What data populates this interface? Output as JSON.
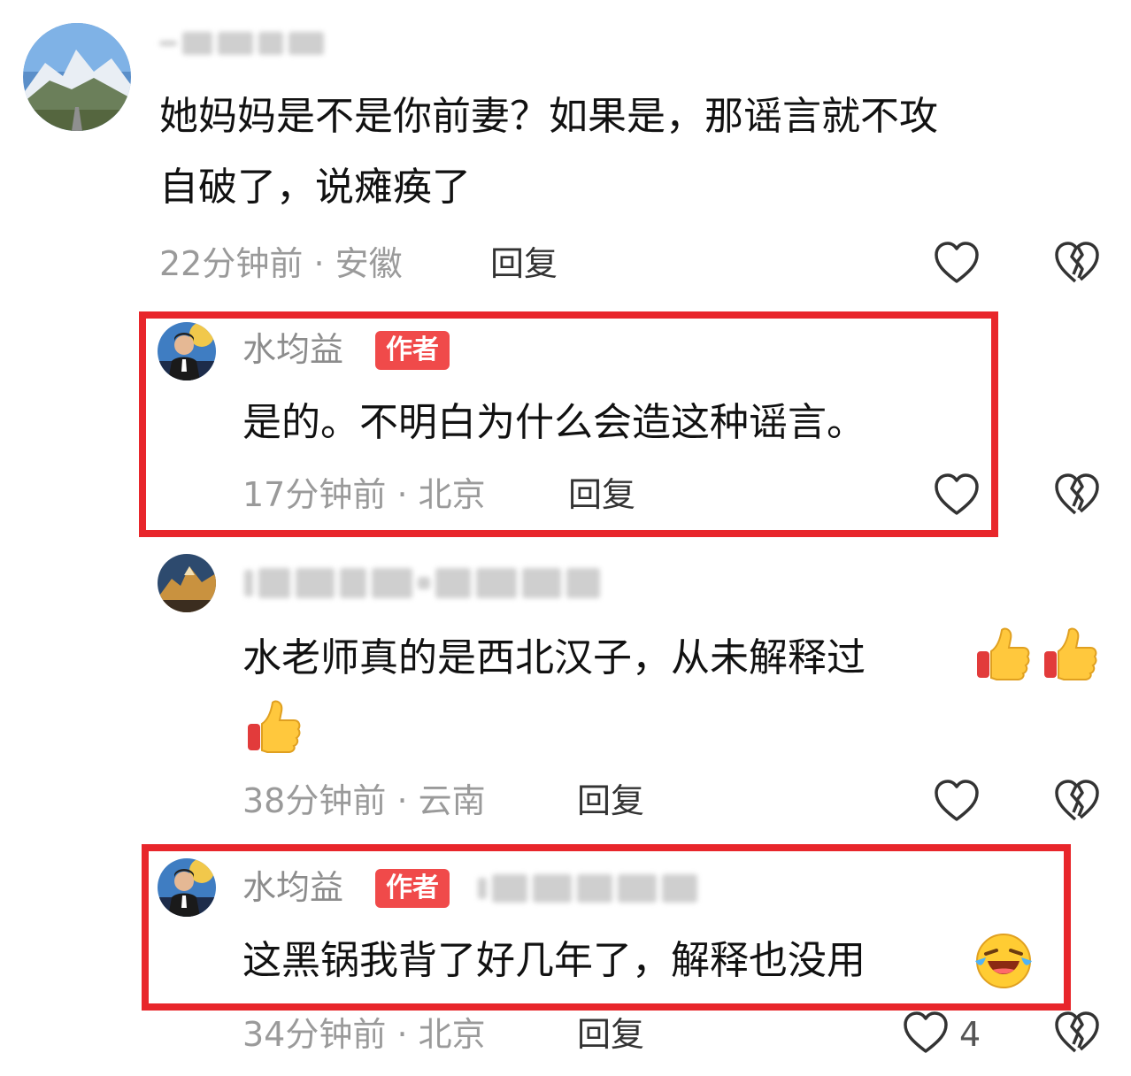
{
  "comments": [
    {
      "text_lines": [
        "她妈妈是不是你前妻？如果是，那谣言就不攻",
        "自破了，说瘫痪了"
      ],
      "time": "22分钟前",
      "location": "安徽",
      "separator": "·",
      "reply_label": "回复"
    },
    {
      "username": "水均益",
      "badge": "作者",
      "text": "是的。不明白为什么会造这种谣言。",
      "time": "17分钟前",
      "location": "北京",
      "separator": "·",
      "reply_label": "回复"
    },
    {
      "text": "水老师真的是西北汉子，从未解释过",
      "emoji_names": [
        "thumbs-up-icon",
        "thumbs-up-icon",
        "thumbs-up-icon"
      ],
      "time": "38分钟前",
      "location": "云南",
      "separator": "·",
      "reply_label": "回复"
    },
    {
      "username": "水均益",
      "badge": "作者",
      "text": "这黑锅我背了好几年了，解释也没用",
      "emoji_names": [
        "laughing-crying-icon"
      ],
      "time": "34分钟前",
      "location": "北京",
      "separator": "·",
      "reply_label": "回复",
      "like_count": "4"
    }
  ],
  "colors": {
    "highlight": "#e8262b",
    "badge": "#f04a4a",
    "meta_text": "#9a9a9a"
  }
}
